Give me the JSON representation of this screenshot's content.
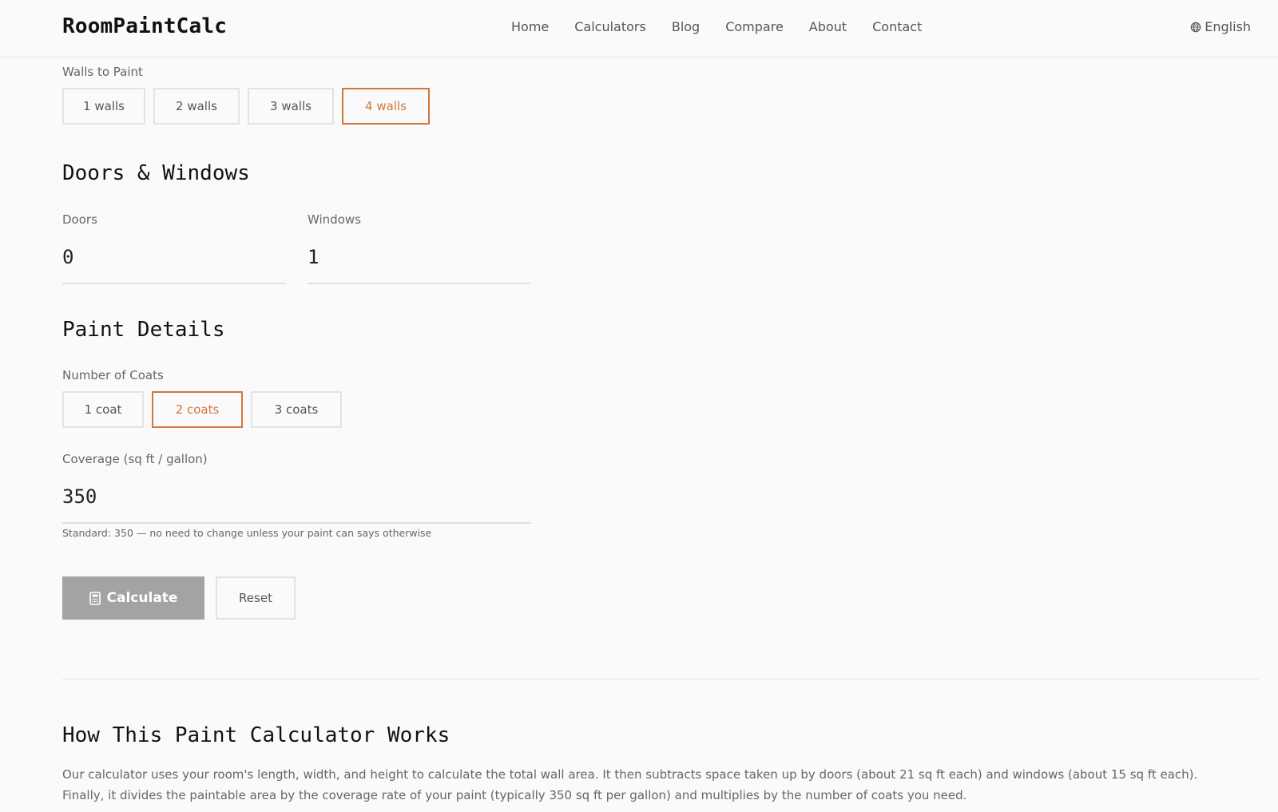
{
  "header": {
    "logo": "RoomPaintCalc",
    "nav": [
      "Home",
      "Calculators",
      "Blog",
      "Compare",
      "About",
      "Contact"
    ],
    "language": "English"
  },
  "walls": {
    "label": "Walls to Paint",
    "options": [
      "1 walls",
      "2 walls",
      "3 walls",
      "4 walls"
    ],
    "selected": "4 walls"
  },
  "doors_windows": {
    "title": "Doors & Windows",
    "doors_label": "Doors",
    "doors_value": "0",
    "windows_label": "Windows",
    "windows_value": "1"
  },
  "paint": {
    "title": "Paint Details",
    "coats_label": "Number of Coats",
    "coats_options": [
      "1 coat",
      "2 coats",
      "3 coats"
    ],
    "coats_selected": "2 coats",
    "coverage_label": "Coverage (sq ft / gallon)",
    "coverage_value": "350",
    "coverage_hint": "Standard: 350 — no need to change unless your paint can says otherwise"
  },
  "actions": {
    "calculate": "Calculate",
    "reset": "Reset"
  },
  "info": {
    "title": "How This Paint Calculator Works",
    "body": "Our calculator uses your room's length, width, and height to calculate the total wall area. It then subtracts space taken up by doors (about 21 sq ft each) and windows (about 15 sq ft each). Finally, it divides the paintable area by the coverage rate of your paint (typically 350 sq ft per gallon) and multiplies by the number of coats you need."
  },
  "colors": {
    "accent": "#d2763a",
    "calculate_bg": "#a3a3a3"
  }
}
